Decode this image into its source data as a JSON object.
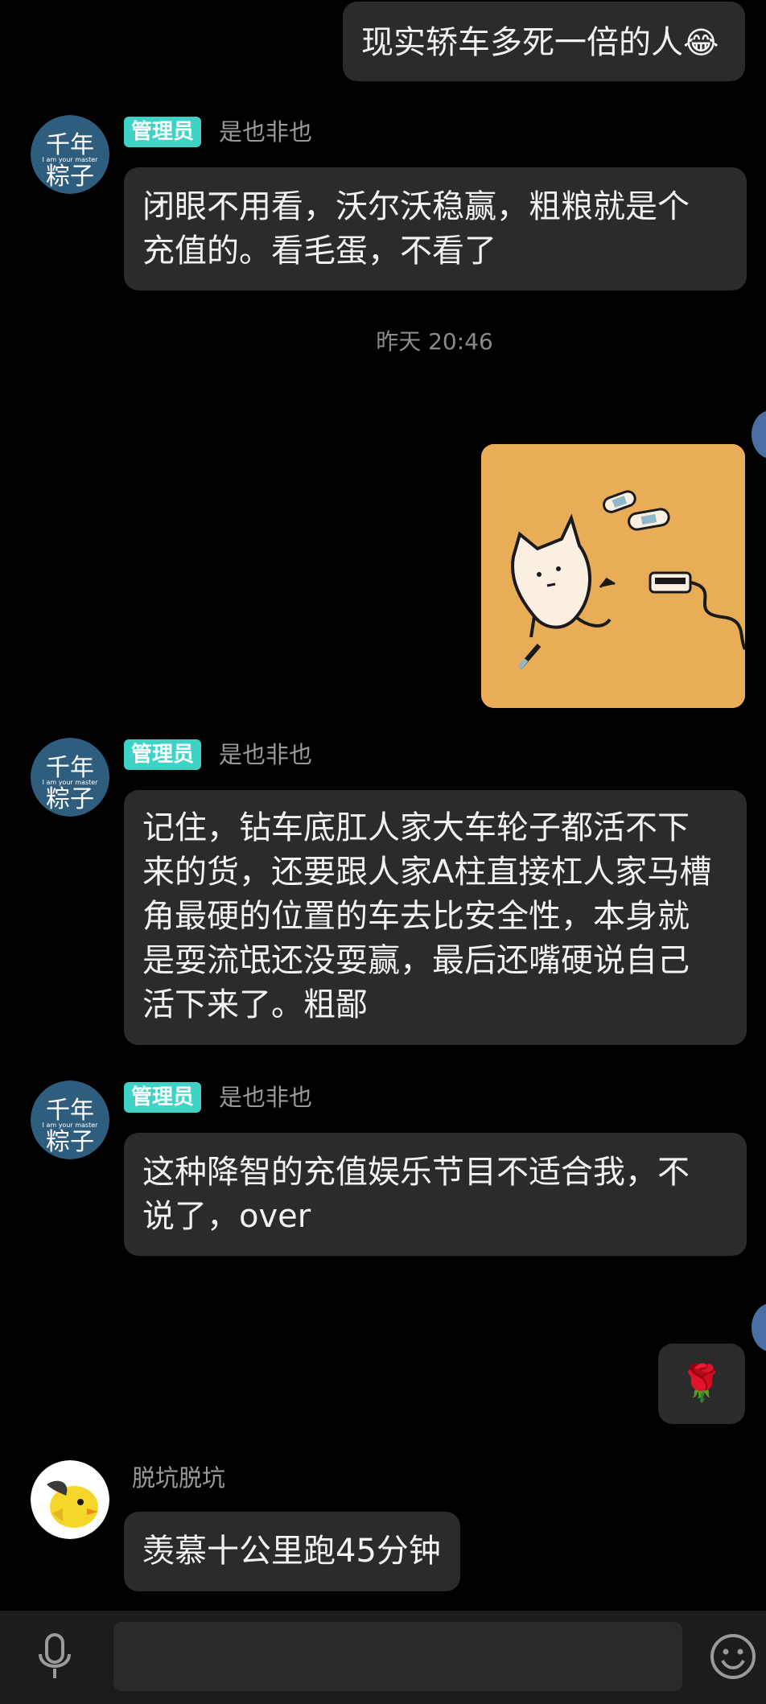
{
  "messages": {
    "m1": {
      "text": "现实轿车多死一倍的人",
      "emoji": "😂"
    },
    "m2": {
      "badge": "管理员",
      "nick": "是也非也",
      "text": "闭眼不用看，沃尔沃稳赢，粗粮就是个\n充值的。看毛蛋，不看了"
    },
    "timestamp": "昨天 20:46",
    "m3": {
      "badge": "管理员",
      "nick": "是也非也",
      "text": "记住，钻车底肛人家大车轮子都活不下\n来的货，还要跟人家A柱直接杠人家马槽\n角最硬的位置的车去比安全性，本身就\n是耍流氓还没耍赢，最后还嘴硬说自己\n活下来了。粗鄙"
    },
    "m4": {
      "badge": "管理员",
      "nick": "是也非也",
      "text": "这种降智的充值娱乐节目不适合我，不\n说了，over"
    },
    "m5": {
      "emoji": "🌹"
    },
    "m6": {
      "nick": "脱坑脱坑",
      "text": "羡慕十公里跑45分钟"
    }
  },
  "avatars": {
    "admin": {
      "lines": [
        "千年",
        "粽子"
      ],
      "subtitle": "I am your master"
    }
  },
  "colors": {
    "badge": "#3fd2c7",
    "bubble": "#2b2b2b",
    "background": "#000000"
  },
  "icons": {
    "mic": "microphone-icon",
    "emoji": "smiley-face-icon"
  }
}
